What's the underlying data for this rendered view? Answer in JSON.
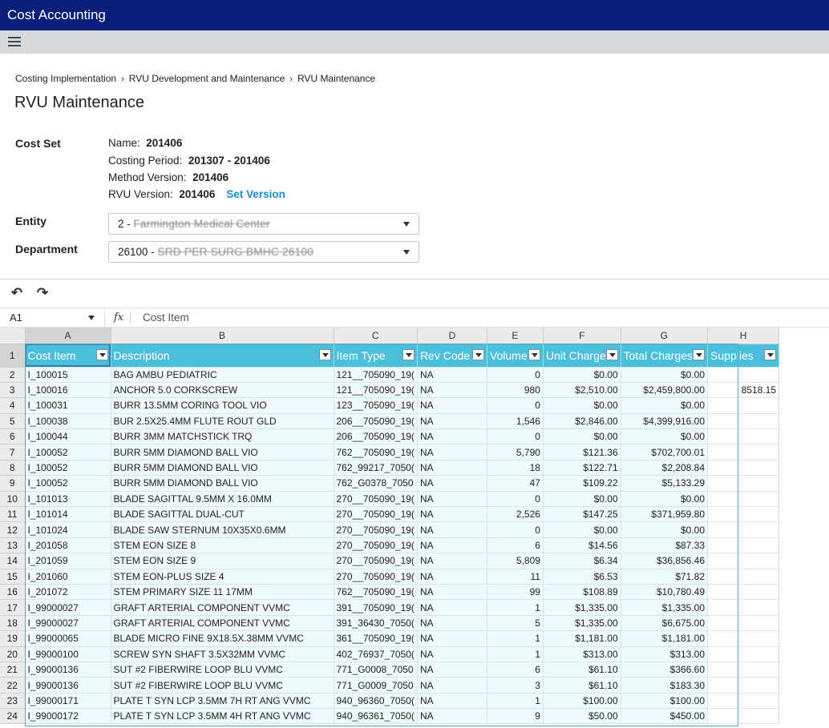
{
  "app": {
    "title": "Cost Accounting"
  },
  "breadcrumb": [
    "Costing Implementation",
    "RVU Development and Maintenance",
    "RVU Maintenance"
  ],
  "page_title": "RVU Maintenance",
  "cost_set": {
    "label": "Cost Set",
    "name_label": "Name:",
    "name_value": "201406",
    "period_label": "Costing Period:",
    "period_value": "201307 - 201406",
    "method_label": "Method Version:",
    "method_value": "201406",
    "rvu_label": "RVU Version:",
    "rvu_value": "201406",
    "set_version_link": "Set Version"
  },
  "entity": {
    "label": "Entity",
    "prefix": "2 - ",
    "value": "Farmington Medical Center"
  },
  "department": {
    "label": "Department",
    "prefix": "26100 - ",
    "value": "SRD PER SURG BMHC 26100"
  },
  "toolbar": {
    "undo_icon": "undo-icon",
    "redo_icon": "redo-icon",
    "undo_glyph": "↶",
    "redo_glyph": "↷"
  },
  "formula_bar": {
    "cell_ref": "A1",
    "fx_label": "fx",
    "content": "Cost Item"
  },
  "grid": {
    "columns": [
      "A",
      "B",
      "C",
      "D",
      "E",
      "F",
      "G",
      "H"
    ],
    "headers": [
      "Cost Item",
      "Description",
      "Item Type",
      "Rev Code",
      "Volume",
      "Unit Charge",
      "Total Charges",
      "Supplies"
    ],
    "rows": [
      [
        "I_100015",
        "BAG AMBU PEDIATRIC",
        "121__705090_19(",
        "NA",
        "0",
        "$0.00",
        "$0.00",
        ""
      ],
      [
        "I_100016",
        "ANCHOR 5.0 CORKSCREW",
        "121__705090_19(",
        "NA",
        "980",
        "$2,510.00",
        "$2,459,800.00",
        "8518.15"
      ],
      [
        "I_100031",
        "BURR 13.5MM CORING TOOL VIO",
        "123__705090_19(",
        "NA",
        "0",
        "$0.00",
        "$0.00",
        ""
      ],
      [
        "I_100038",
        "BUR 2.5X25.4MM FLUTE ROUT GLD",
        "206__705090_19(",
        "NA",
        "1,546",
        "$2,846.00",
        "$4,399,916.00",
        ""
      ],
      [
        "I_100044",
        "BURR 3MM MATCHSTICK TRQ",
        "206__705090_19(",
        "NA",
        "0",
        "$0.00",
        "$0.00",
        ""
      ],
      [
        "I_100052",
        "BURR 5MM DIAMOND BALL VIO",
        "762__705090_19(",
        "NA",
        "5,790",
        "$121.36",
        "$702,700.01",
        ""
      ],
      [
        "I_100052",
        "BURR 5MM DIAMOND BALL VIO",
        "762_99217_7050(",
        "NA",
        "18",
        "$122.71",
        "$2,208.84",
        ""
      ],
      [
        "I_100052",
        "BURR 5MM DIAMOND BALL VIO",
        "762_G0378_7050",
        "NA",
        "47",
        "$109.22",
        "$5,133.29",
        ""
      ],
      [
        "I_101013",
        "BLADE SAGITTAL 9.5MM X 16.0MM",
        "270__705090_19(",
        "NA",
        "0",
        "$0.00",
        "$0.00",
        ""
      ],
      [
        "I_101014",
        "BLADE SAGITTAL DUAL-CUT",
        "270__705090_19(",
        "NA",
        "2,526",
        "$147.25",
        "$371,959.80",
        ""
      ],
      [
        "I_101024",
        "BLADE SAW STERNUM 10X35X0.6MM",
        "270__705090_19(",
        "NA",
        "0",
        "$0.00",
        "$0.00",
        ""
      ],
      [
        "I_201058",
        "STEM EON SIZE 8",
        "270__705090_19(",
        "NA",
        "6",
        "$14.56",
        "$87.33",
        ""
      ],
      [
        "I_201059",
        "STEM EON SIZE 9",
        "270__705090_19(",
        "NA",
        "5,809",
        "$6.34",
        "$36,856.46",
        ""
      ],
      [
        "I_201060",
        "STEM EON-PLUS SIZE 4",
        "270__705090_19(",
        "NA",
        "11",
        "$6.53",
        "$71.82",
        ""
      ],
      [
        "I_201072",
        "STEM PRIMARY SIZE 11 17MM",
        "762__705090_19(",
        "NA",
        "99",
        "$108.89",
        "$10,780.49",
        ""
      ],
      [
        "I_99000027",
        "GRAFT ARTERIAL COMPONENT VVMC",
        "391__705090_19(",
        "NA",
        "1",
        "$1,335.00",
        "$1,335.00",
        ""
      ],
      [
        "I_99000027",
        "GRAFT ARTERIAL COMPONENT VVMC",
        "391_36430_7050(",
        "NA",
        "5",
        "$1,335.00",
        "$6,675.00",
        ""
      ],
      [
        "I_99000065",
        "BLADE MICRO FINE 9X18.5X.38MM VVMC",
        "361__705090_19(",
        "NA",
        "1",
        "$1,181.00",
        "$1,181.00",
        ""
      ],
      [
        "I_99000100",
        "SCREW SYN SHAFT 3.5X32MM VVMC",
        "402_76937_7050(",
        "NA",
        "1",
        "$313.00",
        "$313.00",
        ""
      ],
      [
        "I_99000136",
        "SUT #2 FIBERWIRE LOOP BLU VVMC",
        "771_G0008_7050",
        "NA",
        "6",
        "$61.10",
        "$366.60",
        ""
      ],
      [
        "I_99000136",
        "SUT #2 FIBERWIRE LOOP BLU VVMC",
        "771_G0009_7050",
        "NA",
        "3",
        "$61.10",
        "$183.30",
        ""
      ],
      [
        "I_99000171",
        "PLATE T SYN LCP 3.5MM 7H RT ANG VVMC",
        "940_96360_7050(",
        "NA",
        "1",
        "$100.00",
        "$100.00",
        ""
      ],
      [
        "I_99000172",
        "PLATE T SYN LCP 3.5MM 4H RT ANG VVMC",
        "940_96361_7050(",
        "NA",
        "9",
        "$50.00",
        "$450.00",
        ""
      ]
    ]
  }
}
